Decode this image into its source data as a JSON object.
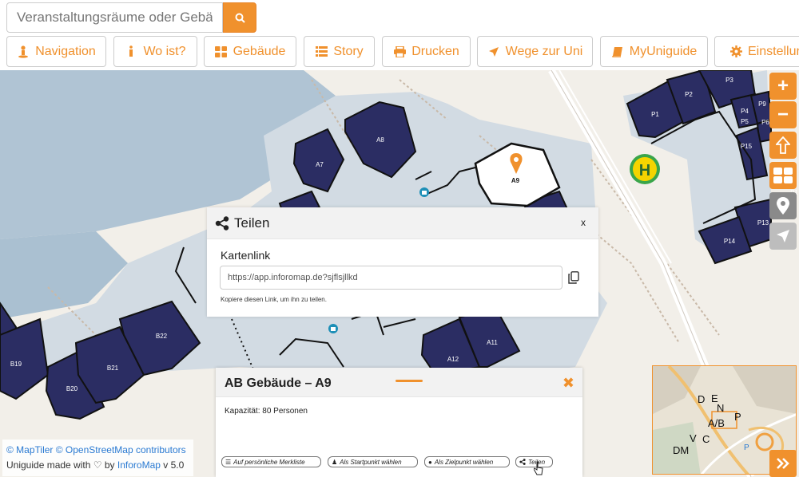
{
  "search": {
    "placeholder": "Veranstaltungsräume oder Gebäude"
  },
  "toolbar": {
    "navigation": "Navigation",
    "wo_ist": "Wo ist?",
    "gebaeude": "Gebäude",
    "story": "Story",
    "drucken": "Drucken",
    "wege": "Wege zur Uni",
    "myuniguide": "MyUniguide",
    "einstellungen": "Einstellun"
  },
  "controls": {
    "zoom_in": "+",
    "zoom_out": "−"
  },
  "map": {
    "buildings": [
      "A7",
      "A8",
      "A9",
      "A11",
      "A12",
      "B19",
      "B20",
      "B21",
      "B22",
      "P1",
      "P2",
      "P3",
      "P4",
      "P5",
      "P6",
      "P9",
      "P13",
      "P14",
      "P15"
    ],
    "selected": "A9",
    "partial_label": "P1"
  },
  "share": {
    "title": "Teilen",
    "close": "x",
    "label": "Kartenlink",
    "url": "https://app.inforomap.de?sjflsjllkd",
    "hint": "Kopiere diesen Link, um ihn zu teilen."
  },
  "info": {
    "title": "AB Gebäude – A9",
    "close": "✖",
    "capacity": "Kapazität: 80 Personen",
    "actions": {
      "merkliste": "Auf persönliche Merkliste",
      "start": "Als Startpunkt wählen",
      "ziel": "Als Zielpunkt wählen",
      "teilen": "Teilen"
    }
  },
  "attribution": {
    "maptiler": "© MapTiler",
    "osm": "© OpenStreetMap contributors",
    "made_with": "Uniguide made with",
    "by": "by",
    "inforomap": "InforoMap",
    "version": "v 5.0"
  },
  "minimap": {
    "labels": [
      "D",
      "E",
      "N",
      "A/B",
      "P",
      "V",
      "C",
      "DM",
      "P"
    ]
  },
  "colors": {
    "accent": "#f0912d",
    "building": "#2b2d63",
    "selected_building": "#ffffff",
    "bus_stop": "#f5d400"
  }
}
